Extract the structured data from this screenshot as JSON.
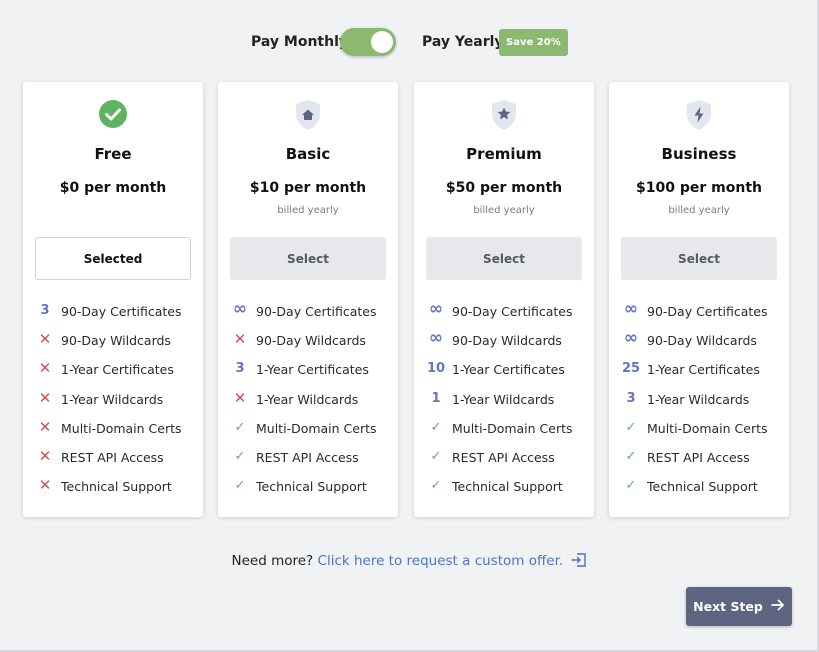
{
  "billing": {
    "monthly_label": "Pay Monthly",
    "yearly_label": "Pay Yearly",
    "save_badge": "Save 20%",
    "toggle_state": "yearly"
  },
  "colors": {
    "accent_green": "#8bba6e",
    "check_green": "#5db460",
    "cross_red": "#d05454",
    "count_purple": "#6474c6",
    "link_blue": "#4e73c9",
    "next_button": "#5d6582"
  },
  "plans": [
    {
      "icon": "check-circle-icon",
      "name": "Free",
      "price": "$0 per month",
      "billing": "",
      "button": "Selected",
      "selected": true,
      "features": [
        {
          "mark": "num",
          "value": "3",
          "label": "90-Day Certificates"
        },
        {
          "mark": "x",
          "value": "✕",
          "label": "90-Day Wildcards"
        },
        {
          "mark": "x",
          "value": "✕",
          "label": "1-Year Certificates"
        },
        {
          "mark": "x",
          "value": "✕",
          "label": "1-Year Wildcards"
        },
        {
          "mark": "x",
          "value": "✕",
          "label": "Multi-Domain Certs"
        },
        {
          "mark": "x",
          "value": "✕",
          "label": "REST API Access"
        },
        {
          "mark": "x",
          "value": "✕",
          "label": "Technical Support"
        }
      ]
    },
    {
      "icon": "shield-home-icon",
      "name": "Basic",
      "price": "$10 per month",
      "billing": "billed yearly",
      "button": "Select",
      "selected": false,
      "features": [
        {
          "mark": "inf",
          "value": "∞",
          "label": "90-Day Certificates"
        },
        {
          "mark": "x",
          "value": "✕",
          "label": "90-Day Wildcards"
        },
        {
          "mark": "num",
          "value": "3",
          "label": "1-Year Certificates"
        },
        {
          "mark": "x",
          "value": "✕",
          "label": "1-Year Wildcards"
        },
        {
          "mark": "check",
          "value": "✓",
          "label": "Multi-Domain Certs"
        },
        {
          "mark": "check",
          "value": "✓",
          "label": "REST API Access"
        },
        {
          "mark": "check",
          "value": "✓",
          "label": "Technical Support"
        }
      ]
    },
    {
      "icon": "shield-star-icon",
      "name": "Premium",
      "price": "$50 per month",
      "billing": "billed yearly",
      "button": "Select",
      "selected": false,
      "features": [
        {
          "mark": "inf",
          "value": "∞",
          "label": "90-Day Certificates"
        },
        {
          "mark": "inf",
          "value": "∞",
          "label": "90-Day Wildcards"
        },
        {
          "mark": "num",
          "value": "10",
          "label": "1-Year Certificates"
        },
        {
          "mark": "num",
          "value": "1",
          "label": "1-Year Wildcards"
        },
        {
          "mark": "check",
          "value": "✓",
          "label": "Multi-Domain Certs"
        },
        {
          "mark": "check",
          "value": "✓",
          "label": "REST API Access"
        },
        {
          "mark": "check",
          "value": "✓",
          "label": "Technical Support"
        }
      ]
    },
    {
      "icon": "shield-bolt-icon",
      "name": "Business",
      "price": "$100 per month",
      "billing": "billed yearly",
      "button": "Select",
      "selected": false,
      "features": [
        {
          "mark": "inf",
          "value": "∞",
          "label": "90-Day Certificates"
        },
        {
          "mark": "inf",
          "value": "∞",
          "label": "90-Day Wildcards"
        },
        {
          "mark": "num",
          "value": "25",
          "label": "1-Year Certificates"
        },
        {
          "mark": "num",
          "value": "3",
          "label": "1-Year Wildcards"
        },
        {
          "mark": "check",
          "value": "✓",
          "label": "Multi-Domain Certs"
        },
        {
          "mark": "check",
          "value": "✓",
          "label": "REST API Access"
        },
        {
          "mark": "check",
          "value": "✓",
          "label": "Technical Support"
        }
      ]
    }
  ],
  "footer": {
    "need_more": "Need more?",
    "custom_offer_link": "Click here to request a custom offer.",
    "custom_offer_icon": "external-link-icon",
    "next_step": "Next Step",
    "next_icon": "arrow-right-icon"
  }
}
